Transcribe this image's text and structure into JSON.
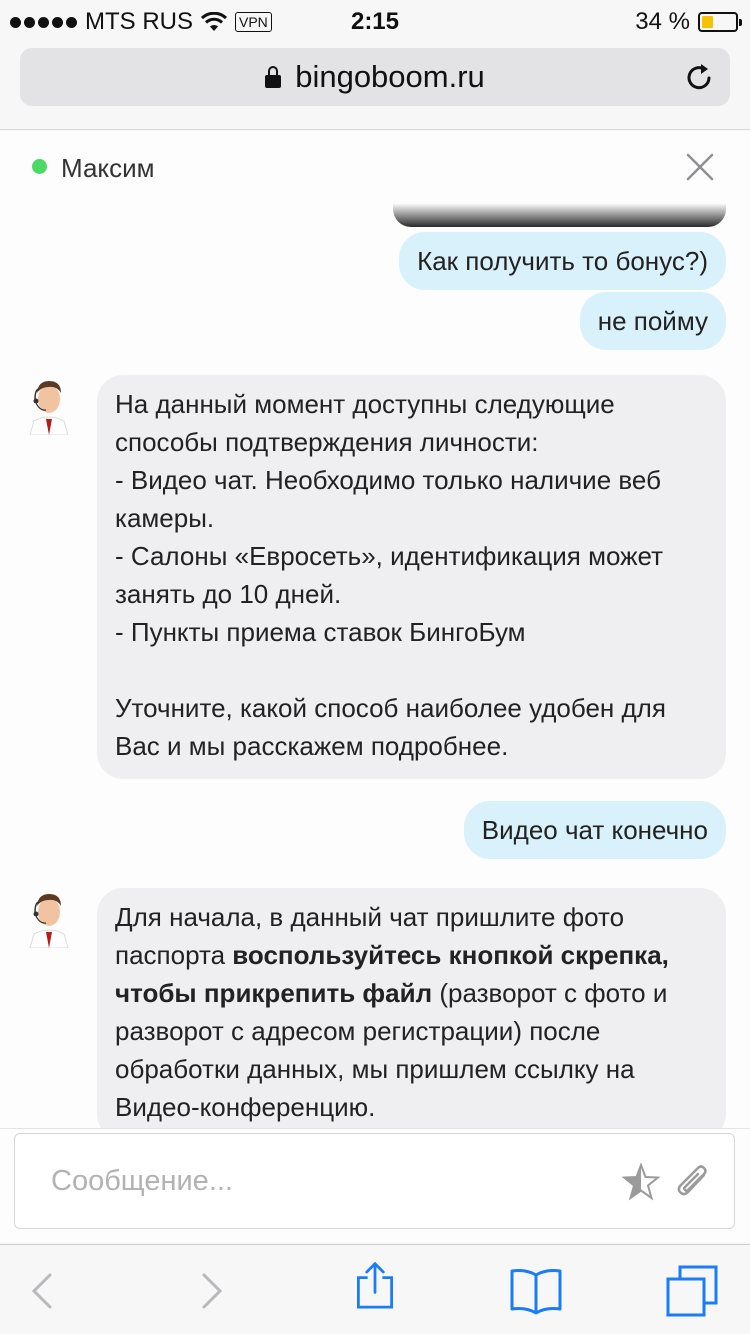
{
  "status_bar": {
    "carrier": "MTS RUS",
    "vpn": "VPN",
    "time": "2:15",
    "battery_text": "34 %",
    "battery_level": 0.34
  },
  "browser": {
    "url": "bingoboom.ru"
  },
  "chat": {
    "agent_name": "Максим",
    "messages": [
      {
        "from": "user",
        "text": "Как получить то бонус?)"
      },
      {
        "from": "user",
        "text": "не пойму"
      },
      {
        "from": "agent",
        "text": "На данный момент доступны следующие способы подтверждения личности:\n- Видео чат. Необходимо только наличие веб камеры.\n- Салоны «Евросеть», идентификация может занять до 10 дней.\n- Пункты приема ставок БингоБум\n\nУточните, какой способ наиболее удобен для Вас и мы расскажем подробнее."
      },
      {
        "from": "user",
        "text": "Видео чат конечно"
      },
      {
        "from": "agent",
        "text_part1": "Для начала, в данный чат пришлите фото паспорта ",
        "text_bold": "воспользуйтесь кнопкой скрепка, чтобы прикрепить файл",
        "text_part2": " (разворот с фото и разворот с адресом регистрации)  после обработки данных, мы пришлем ссылку на Видео-конференцию."
      }
    ],
    "input_placeholder": "Сообщение..."
  },
  "colors": {
    "online": "#4cd964",
    "user_bubble": "#d9f1fa",
    "agent_bubble": "#efeff2",
    "toolbar_blue": "#1a7cf6"
  },
  "icons": [
    "lock-icon",
    "reload-icon",
    "close-icon",
    "star-icon",
    "paperclip-icon",
    "back-icon",
    "forward-icon",
    "share-icon",
    "bookmarks-icon",
    "tabs-icon"
  ]
}
